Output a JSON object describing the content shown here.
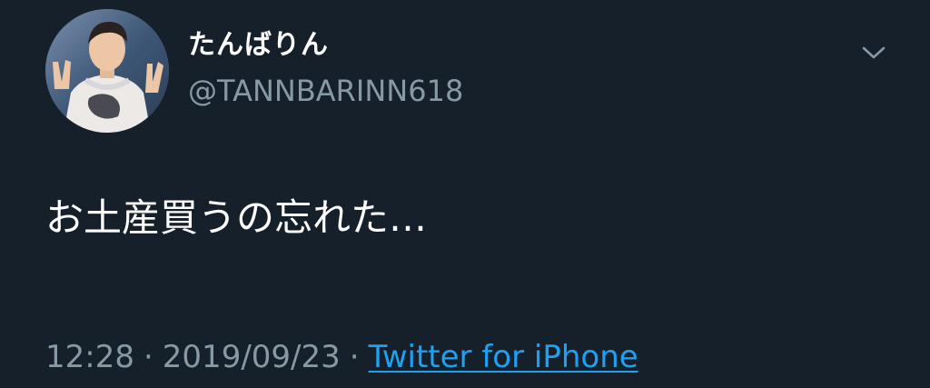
{
  "tweet": {
    "author": {
      "display_name": "たんばりん",
      "handle": "@TANNBARINN618",
      "avatar_icon": "avatar-photo"
    },
    "more_icon": "chevron-down-icon",
    "text": "お土産買うの忘れた…",
    "meta": {
      "time": "12:28",
      "date": "2019/09/23",
      "separator": "·",
      "source": "Twitter for iPhone"
    }
  },
  "colors": {
    "background": "#15202b",
    "primary_text": "#ffffff",
    "secondary_text": "#8899a6",
    "link": "#1da1f2"
  }
}
